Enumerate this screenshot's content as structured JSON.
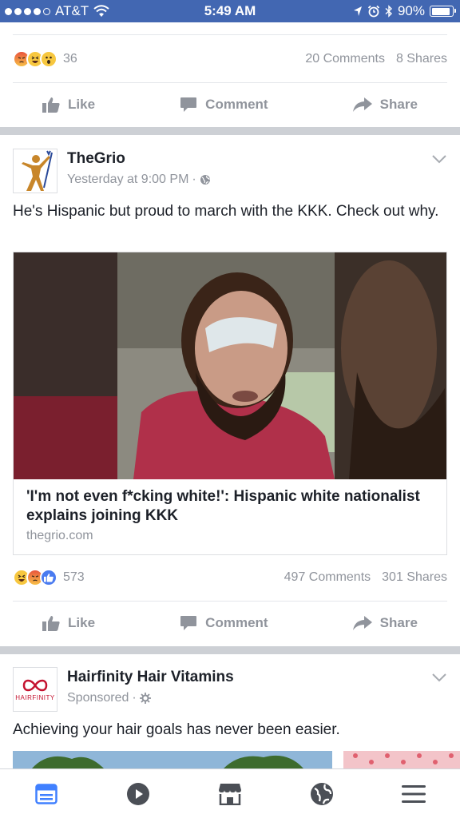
{
  "status_bar": {
    "carrier": "AT&T",
    "time": "5:49 AM",
    "battery": "90%",
    "battery_level": 0.9
  },
  "post_prev": {
    "reaction_count": "36",
    "comments": "20 Comments",
    "shares": "8 Shares"
  },
  "actions": {
    "like": "Like",
    "comment": "Comment",
    "share": "Share"
  },
  "post_grio": {
    "page_name": "TheGrio",
    "timestamp": "Yesterday at 9:00 PM",
    "separator": "·",
    "text": "He's Hispanic but proud to march with the KKK. Check out why.",
    "link_title": "'I'm not even f*cking white!': Hispanic white nationalist explains joining KKK",
    "link_domain": "thegrio.com",
    "reaction_count": "573",
    "comments": "497 Comments",
    "shares": "301 Shares"
  },
  "post_hairfinity": {
    "page_name": "Hairfinity Hair Vitamins",
    "sponsored": "Sponsored",
    "separator": "·",
    "logo_text": "HAIRFINITY",
    "text": "Achieving your hair goals has never been easier."
  },
  "colors": {
    "brand": "#4267b2",
    "meta": "#90949c",
    "tab_active": "#4080ff"
  },
  "tab_bar": {
    "icons": [
      "news-feed-icon",
      "video-icon",
      "marketplace-icon",
      "notifications-globe-icon",
      "menu-icon"
    ],
    "active": "news-feed-icon"
  }
}
